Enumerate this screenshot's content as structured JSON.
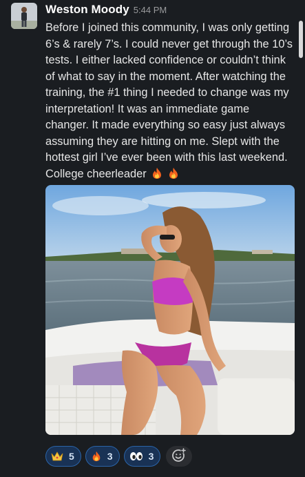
{
  "message": {
    "author": "Weston Moody",
    "time": "5:44 PM",
    "text": "Before I joined this community, I was only getting 6’s & rarely 7’s. I could never get through the 10’s tests. I either lacked confidence or couldn’t think of what to say in the moment. After watching the training, the #1 thing I needed to change was my interpretation! It was an immediate game changer. It made everything so easy just always assuming they are hitting on me. Slept with the hottest girl I’ve ever been with this last weekend. College cheerleader",
    "emoji": [
      "fire",
      "fire"
    ]
  },
  "reactions": [
    {
      "icon": "crown-icon",
      "count": "5"
    },
    {
      "icon": "fire-icon",
      "count": "3"
    },
    {
      "icon": "eyes-icon",
      "count": "3"
    }
  ],
  "colors": {
    "background": "#1a1d21",
    "reaction_bg": "#193255",
    "reaction_border": "#2b64a8"
  }
}
